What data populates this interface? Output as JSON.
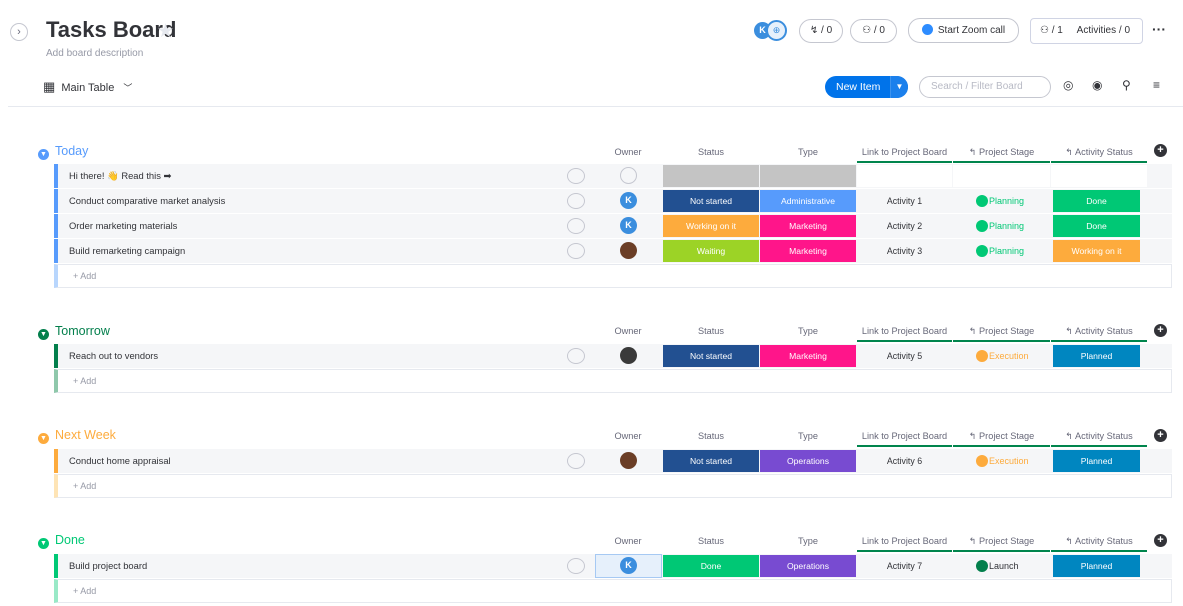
{
  "board": {
    "title": "Tasks Board",
    "description": "Add board description",
    "view_label": "Main Table",
    "avatar_initial": "K",
    "invites_count": "/ 0",
    "integrations_count": "/ 0",
    "zoom_label": "Start Zoom call",
    "members_label": "/ 1",
    "activities_label": "Activities / 0",
    "new_item_label": "New Item",
    "search_placeholder": "Search / Filter Board"
  },
  "columns": {
    "owner": "Owner",
    "status": "Status",
    "type": "Type",
    "link": "Link to Project Board",
    "stage": "Project Stage",
    "activity": "Activity Status"
  },
  "add_label": "+ Add",
  "colors": {
    "today": "#579bfc",
    "tomorrow": "#037f4c",
    "next_week": "#fdab3d",
    "done": "#00c875",
    "not_started": "#225091",
    "working": "#fdab3d",
    "waiting": "#9cd326",
    "done_status": "#00c875",
    "administrative": "#579bfc",
    "marketing": "#ff158a",
    "operations": "#784bd1",
    "planning": "#00c875",
    "execution": "#fdab3d",
    "launch": "#037f4c",
    "planned": "#0086c0"
  },
  "groups": [
    {
      "title": "Today",
      "rows": [
        {
          "name": "Hi there! 👋 Read this ➡",
          "status": "",
          "type": "",
          "link": "",
          "stage": "",
          "activity": ""
        },
        {
          "name": "Conduct comparative market analysis",
          "status": "Not started",
          "type": "Administrative",
          "link": "Activity 1",
          "stage": "Planning",
          "activity": "Done"
        },
        {
          "name": "Order marketing materials",
          "status": "Working on it",
          "type": "Marketing",
          "link": "Activity 2",
          "stage": "Planning",
          "activity": "Done"
        },
        {
          "name": "Build remarketing campaign",
          "status": "Waiting",
          "type": "Marketing",
          "link": "Activity 3",
          "stage": "Planning",
          "activity": "Working on it"
        }
      ]
    },
    {
      "title": "Tomorrow",
      "rows": [
        {
          "name": "Reach out to vendors",
          "status": "Not started",
          "type": "Marketing",
          "link": "Activity 5",
          "stage": "Execution",
          "activity": "Planned"
        }
      ]
    },
    {
      "title": "Next Week",
      "rows": [
        {
          "name": "Conduct home appraisal",
          "status": "Not started",
          "type": "Operations",
          "link": "Activity 6",
          "stage": "Execution",
          "activity": "Planned"
        }
      ]
    },
    {
      "title": "Done",
      "rows": [
        {
          "name": "Build project board",
          "status": "Done",
          "type": "Operations",
          "link": "Activity 7",
          "stage": "Launch",
          "activity": "Planned"
        }
      ]
    }
  ]
}
